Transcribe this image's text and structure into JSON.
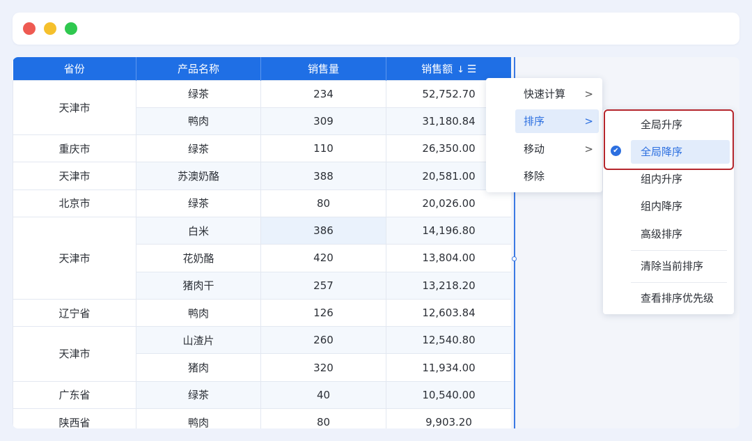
{
  "window": {
    "controls": [
      "close",
      "minimize",
      "maximize"
    ]
  },
  "table": {
    "headers": [
      "省份",
      "产品名称",
      "销售量",
      "销售额"
    ],
    "sort_indicator": "↓",
    "header_menu_icon": "☰",
    "rows": [
      {
        "province": "天津市",
        "product": "绿茶",
        "qty": "234",
        "amount": "52,752.70"
      },
      {
        "product": "鸭肉",
        "qty": "309",
        "amount": "31,180.84"
      },
      {
        "province": "重庆市",
        "product": "绿茶",
        "qty": "110",
        "amount": "26,350.00"
      },
      {
        "province": "天津市",
        "product": "苏澳奶酪",
        "qty": "388",
        "amount": "20,581.00"
      },
      {
        "province": "北京市",
        "product": "绿茶",
        "qty": "80",
        "amount": "20,026.00"
      },
      {
        "province": "天津市",
        "product": "白米",
        "qty": "386",
        "amount": "14,196.80"
      },
      {
        "product": "花奶酪",
        "qty": "420",
        "amount": "13,804.00"
      },
      {
        "product": "猪肉干",
        "qty": "257",
        "amount": "13,218.20"
      },
      {
        "province": "辽宁省",
        "product": "鸭肉",
        "qty": "126",
        "amount": "12,603.84"
      },
      {
        "province": "天津市",
        "product": "山渣片",
        "qty": "260",
        "amount": "12,540.80"
      },
      {
        "product": "猪肉",
        "qty": "320",
        "amount": "11,934.00"
      },
      {
        "province": "广东省",
        "product": "绿茶",
        "qty": "40",
        "amount": "10,540.00"
      },
      {
        "province": "陕西省",
        "product": "鸭肉",
        "qty": "80",
        "amount": "9,903.20"
      }
    ]
  },
  "context_menu": {
    "items": [
      {
        "label": "快速计算",
        "has_submenu": true
      },
      {
        "label": "排序",
        "has_submenu": true,
        "active": true
      },
      {
        "label": "移动",
        "has_submenu": true
      },
      {
        "label": "移除",
        "has_submenu": false
      }
    ],
    "chevron": ">"
  },
  "sort_submenu": {
    "items": [
      {
        "label": "全局升序"
      },
      {
        "label": "全局降序",
        "selected": true
      },
      {
        "label": "组内升序"
      },
      {
        "label": "组内降序"
      },
      {
        "label": "高级排序"
      },
      {
        "label": "清除当前排序"
      },
      {
        "label": "查看排序优先级"
      }
    ],
    "check_icon": "✔"
  },
  "colors": {
    "header_bg": "#1f6fe5",
    "accent": "#2c6fe0",
    "highlight_border": "#b5262c",
    "background": "#eef2fb"
  }
}
